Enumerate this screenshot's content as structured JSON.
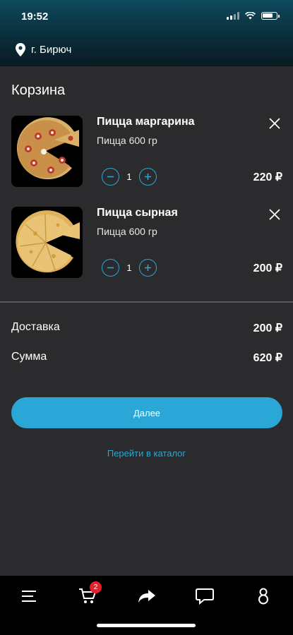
{
  "status_bar": {
    "time": "19:52"
  },
  "header": {
    "city": "г. Бирюч"
  },
  "page": {
    "title": "Корзина"
  },
  "cart": {
    "items": [
      {
        "name": "Пицца маргарина",
        "description": "Пицца 600 гр",
        "quantity": "1",
        "price": "220 ₽"
      },
      {
        "name": "Пицца сырная",
        "description": "Пицца 600 гр",
        "quantity": "1",
        "price": "200 ₽"
      }
    ]
  },
  "summary": {
    "delivery_label": "Доставка",
    "delivery_value": "200 ₽",
    "total_label": "Сумма",
    "total_value": "620 ₽"
  },
  "actions": {
    "next_label": "Далее",
    "catalog_link": "Перейти в каталог"
  },
  "tabbar": {
    "cart_badge": "2",
    "tabs": [
      "menu-icon",
      "cart-icon",
      "share-icon",
      "chat-icon",
      "profile-icon"
    ]
  },
  "colors": {
    "accent": "#2aa7d6",
    "badge": "#e3202b",
    "background": "#2b2b2d"
  }
}
